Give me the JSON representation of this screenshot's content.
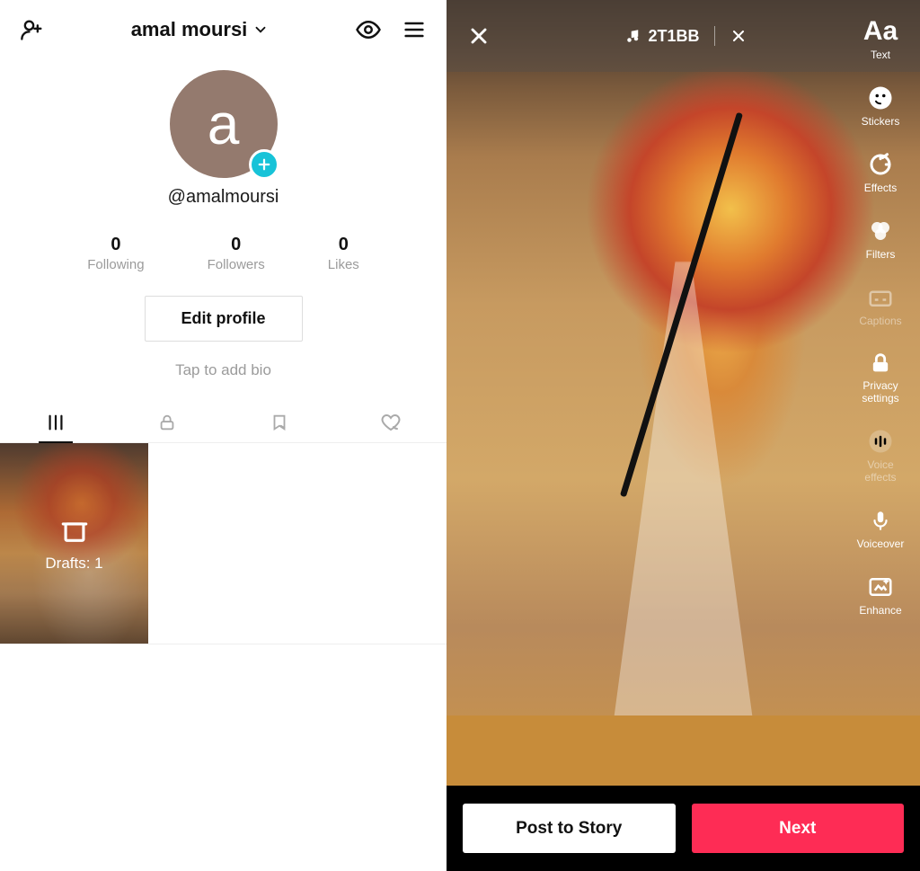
{
  "profile": {
    "header": {
      "display_name": "amal moursi"
    },
    "avatar_letter": "a",
    "handle": "@amalmoursi",
    "stats": [
      {
        "value": "0",
        "label": "Following"
      },
      {
        "value": "0",
        "label": "Followers"
      },
      {
        "value": "0",
        "label": "Likes"
      }
    ],
    "edit_button": "Edit profile",
    "bio_hint": "Tap to add bio",
    "drafts_label": "Drafts: 1"
  },
  "editor": {
    "music_label": "2T1BB",
    "tools": [
      {
        "key": "text",
        "label": "Text",
        "glyph": "Aa",
        "dim": false
      },
      {
        "key": "stickers",
        "label": "Stickers",
        "dim": false
      },
      {
        "key": "effects",
        "label": "Effects",
        "dim": false
      },
      {
        "key": "filters",
        "label": "Filters",
        "dim": false
      },
      {
        "key": "captions",
        "label": "Captions",
        "dim": true
      },
      {
        "key": "privacy",
        "label": "Privacy settings",
        "dim": false
      },
      {
        "key": "voicefx",
        "label": "Voice effects",
        "dim": true
      },
      {
        "key": "voiceover",
        "label": "Voiceover",
        "dim": false
      },
      {
        "key": "enhance",
        "label": "Enhance",
        "dim": false
      }
    ],
    "post_story": "Post to Story",
    "next": "Next"
  }
}
